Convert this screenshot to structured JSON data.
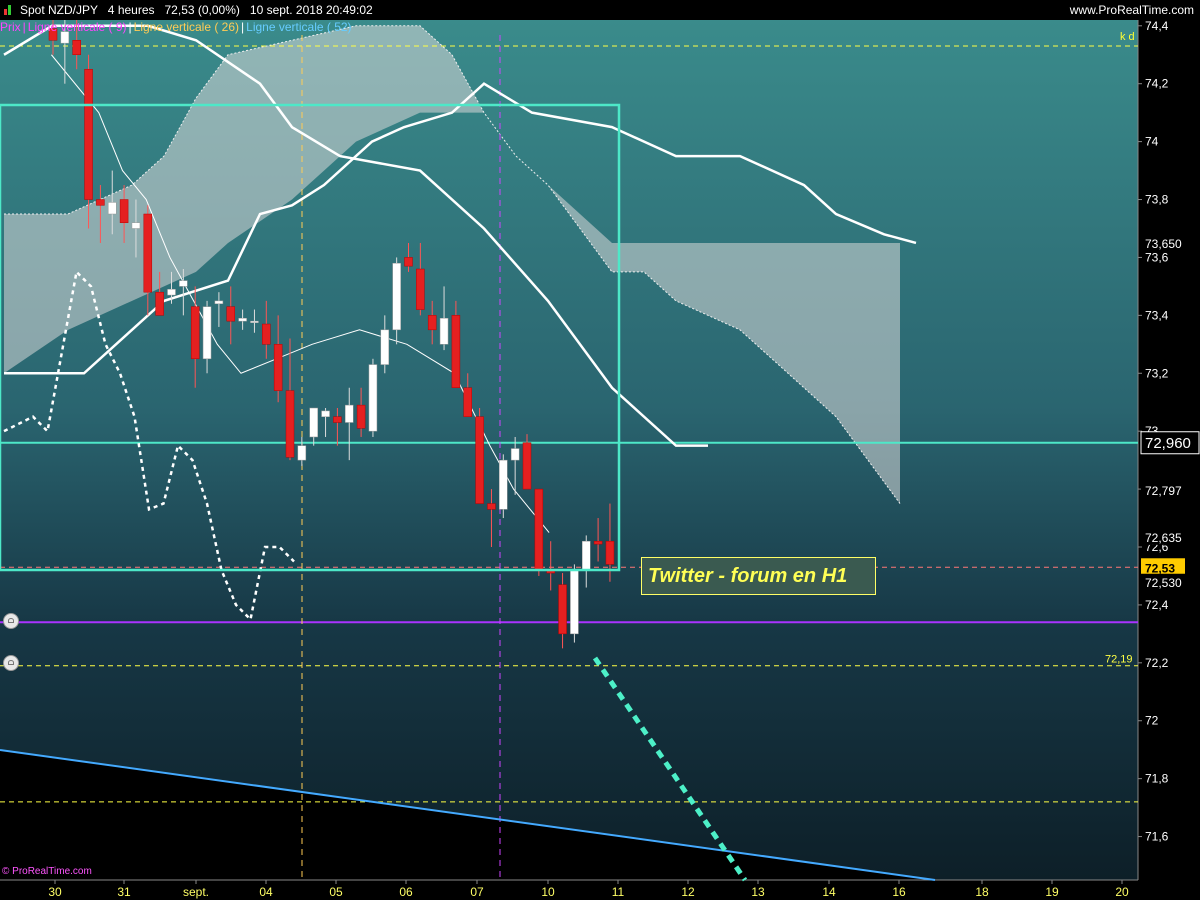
{
  "header": {
    "title": "Spot NZD/JPY   4 heures   72,53 (0,00%)   10 sept. 2018 20:49:02",
    "site": "www.ProRealTime.com"
  },
  "legend": [
    {
      "label": "Prix",
      "color": "#ff44ff"
    },
    {
      "label": "Ligne verticale ( 9)",
      "color": "#ff44ff"
    },
    {
      "label": "Ligne verticale ( 26)",
      "color": "#ffcc55"
    },
    {
      "label": "Ligne verticale ( 52)",
      "color": "#66ccff"
    }
  ],
  "annotation": {
    "kd": "k d",
    "twitter": "Twitter - forum en H1",
    "level": "72,19"
  },
  "footer": {
    "copyright": "© ProRealTime.com"
  },
  "colors": {
    "up": "#ffffff",
    "down": "#e52020",
    "cloud": "#d8d8d8",
    "box": "#4de8c8",
    "trend": "#4df0c8",
    "support": "#44aaff"
  },
  "chart_data": {
    "type": "candlestick",
    "ylim": [
      71.45,
      74.42
    ],
    "y_ticks": [
      "74,4",
      "74,2",
      "74",
      "73,8",
      "73,6",
      "73,4",
      "73,2",
      "73",
      "72,8",
      "72,6",
      "72,4",
      "72,2",
      "72",
      "71,8",
      "71,6"
    ],
    "price_labels": [
      {
        "text": "72,960",
        "value": 72.96,
        "style": "box-white"
      },
      {
        "text": "73,650",
        "value": 73.65,
        "style": "plain"
      },
      {
        "text": "72,797",
        "value": 72.797,
        "style": "plain"
      },
      {
        "text": "72,635",
        "value": 72.635,
        "style": "plain"
      },
      {
        "text": "72,53",
        "value": 72.53,
        "style": "box-yellow"
      },
      {
        "text": "72,530",
        "value": 72.48,
        "style": "plain"
      }
    ],
    "x_ticks": [
      "30",
      "31",
      "sept.",
      "04",
      "05",
      "06",
      "07",
      "10",
      "11",
      "12",
      "13",
      "14",
      "16",
      "18",
      "19",
      "20"
    ],
    "horizontal_lines": [
      {
        "value": 74.33,
        "color": "#ffff44",
        "dash": true
      },
      {
        "value": 72.96,
        "color": "#4de8c8",
        "dash": false
      },
      {
        "value": 72.53,
        "color": "#ff7777",
        "dash": true
      },
      {
        "value": 72.34,
        "color": "#aa33ff",
        "dash": false
      },
      {
        "value": 72.19,
        "color": "#ffff44",
        "dash": true
      },
      {
        "value": 71.72,
        "color": "#ffff44",
        "dash": true
      }
    ],
    "candles": [
      {
        "o": 74.39,
        "h": 74.42,
        "l": 74.3,
        "c": 74.35
      },
      {
        "o": 74.34,
        "h": 74.42,
        "l": 74.2,
        "c": 74.38
      },
      {
        "o": 74.35,
        "h": 74.42,
        "l": 74.25,
        "c": 74.3
      },
      {
        "o": 74.25,
        "h": 74.3,
        "l": 73.7,
        "c": 73.8
      },
      {
        "o": 73.8,
        "h": 73.85,
        "l": 73.65,
        "c": 73.78
      },
      {
        "o": 73.75,
        "h": 73.9,
        "l": 73.68,
        "c": 73.79
      },
      {
        "o": 73.8,
        "h": 73.85,
        "l": 73.65,
        "c": 73.72
      },
      {
        "o": 73.7,
        "h": 73.8,
        "l": 73.6,
        "c": 73.72
      },
      {
        "o": 73.75,
        "h": 73.78,
        "l": 73.4,
        "c": 73.48
      },
      {
        "o": 73.48,
        "h": 73.55,
        "l": 73.4,
        "c": 73.4
      },
      {
        "o": 73.47,
        "h": 73.55,
        "l": 73.44,
        "c": 73.49
      },
      {
        "o": 73.5,
        "h": 73.56,
        "l": 73.4,
        "c": 73.52
      },
      {
        "o": 73.43,
        "h": 73.5,
        "l": 73.15,
        "c": 73.25
      },
      {
        "o": 73.25,
        "h": 73.45,
        "l": 73.2,
        "c": 73.43
      },
      {
        "o": 73.44,
        "h": 73.48,
        "l": 73.36,
        "c": 73.45
      },
      {
        "o": 73.43,
        "h": 73.5,
        "l": 73.3,
        "c": 73.38
      },
      {
        "o": 73.38,
        "h": 73.42,
        "l": 73.35,
        "c": 73.39
      },
      {
        "o": 73.38,
        "h": 73.42,
        "l": 73.34,
        "c": 73.38
      },
      {
        "o": 73.37,
        "h": 73.45,
        "l": 73.25,
        "c": 73.3
      },
      {
        "o": 73.3,
        "h": 73.4,
        "l": 73.1,
        "c": 73.14
      },
      {
        "o": 73.14,
        "h": 73.32,
        "l": 72.9,
        "c": 72.91
      },
      {
        "o": 72.9,
        "h": 72.98,
        "l": 72.88,
        "c": 72.95
      },
      {
        "o": 72.98,
        "h": 73.05,
        "l": 72.95,
        "c": 73.08
      },
      {
        "o": 73.05,
        "h": 73.08,
        "l": 72.98,
        "c": 73.07
      },
      {
        "o": 73.05,
        "h": 73.08,
        "l": 72.95,
        "c": 73.03
      },
      {
        "o": 73.03,
        "h": 73.15,
        "l": 72.9,
        "c": 73.09
      },
      {
        "o": 73.09,
        "h": 73.15,
        "l": 72.98,
        "c": 73.01
      },
      {
        "o": 73.0,
        "h": 73.25,
        "l": 72.98,
        "c": 73.23
      },
      {
        "o": 73.23,
        "h": 73.4,
        "l": 73.2,
        "c": 73.35
      },
      {
        "o": 73.35,
        "h": 73.6,
        "l": 73.3,
        "c": 73.58
      },
      {
        "o": 73.6,
        "h": 73.65,
        "l": 73.55,
        "c": 73.57
      },
      {
        "o": 73.56,
        "h": 73.65,
        "l": 73.4,
        "c": 73.42
      },
      {
        "o": 73.4,
        "h": 73.45,
        "l": 73.3,
        "c": 73.35
      },
      {
        "o": 73.3,
        "h": 73.5,
        "l": 73.28,
        "c": 73.39
      },
      {
        "o": 73.4,
        "h": 73.45,
        "l": 73.15,
        "c": 73.15
      },
      {
        "o": 73.15,
        "h": 73.2,
        "l": 73.05,
        "c": 73.05
      },
      {
        "o": 73.05,
        "h": 73.08,
        "l": 72.75,
        "c": 72.75
      },
      {
        "o": 72.75,
        "h": 72.8,
        "l": 72.6,
        "c": 72.73
      },
      {
        "o": 72.73,
        "h": 72.92,
        "l": 72.7,
        "c": 72.9
      },
      {
        "o": 72.9,
        "h": 72.98,
        "l": 72.78,
        "c": 72.94
      },
      {
        "o": 72.96,
        "h": 72.99,
        "l": 72.8,
        "c": 72.8
      },
      {
        "o": 72.8,
        "h": 72.8,
        "l": 72.5,
        "c": 72.52
      },
      {
        "o": 72.52,
        "h": 72.62,
        "l": 72.45,
        "c": 72.51
      },
      {
        "o": 72.47,
        "h": 72.51,
        "l": 72.25,
        "c": 72.3
      },
      {
        "o": 72.3,
        "h": 72.54,
        "l": 72.27,
        "c": 72.52
      },
      {
        "o": 72.52,
        "h": 72.64,
        "l": 72.46,
        "c": 72.62
      },
      {
        "o": 72.62,
        "h": 72.7,
        "l": 72.55,
        "c": 72.61
      },
      {
        "o": 72.62,
        "h": 72.75,
        "l": 72.48,
        "c": 72.54
      }
    ],
    "series": [
      {
        "style": "white-thick",
        "values": [
          [
            0,
            74.3
          ],
          [
            3,
            74.4
          ],
          [
            9,
            74.4
          ],
          [
            12,
            74.35
          ],
          [
            16,
            74.2
          ],
          [
            18,
            74.05
          ],
          [
            21,
            73.95
          ],
          [
            26,
            73.9
          ],
          [
            30,
            73.7
          ],
          [
            34,
            73.45
          ],
          [
            38,
            73.15
          ],
          [
            42,
            72.95
          ],
          [
            44,
            72.95
          ]
        ]
      },
      {
        "style": "white-thick-2",
        "values": [
          [
            0,
            73.2
          ],
          [
            5,
            73.2
          ],
          [
            8,
            73.35
          ],
          [
            10,
            73.45
          ],
          [
            14,
            73.52
          ],
          [
            16,
            73.75
          ],
          [
            18,
            73.78
          ],
          [
            20,
            73.85
          ],
          [
            23,
            74.0
          ],
          [
            25,
            74.05
          ],
          [
            28,
            74.1
          ],
          [
            30,
            74.2
          ],
          [
            33,
            74.1
          ],
          [
            38,
            74.05
          ],
          [
            42,
            73.95
          ],
          [
            46,
            73.95
          ],
          [
            50,
            73.85
          ],
          [
            52,
            73.75
          ],
          [
            55,
            73.68
          ],
          [
            57,
            73.65
          ]
        ]
      },
      {
        "style": "white-thin",
        "values": [
          [
            4,
            74.3
          ],
          [
            8,
            74.1
          ],
          [
            10,
            73.9
          ],
          [
            12,
            73.8
          ],
          [
            14,
            73.6
          ],
          [
            16,
            73.45
          ],
          [
            18,
            73.3
          ],
          [
            20,
            73.2
          ],
          [
            23,
            73.25
          ],
          [
            26,
            73.3
          ],
          [
            30,
            73.35
          ],
          [
            34,
            73.3
          ],
          [
            38,
            73.2
          ],
          [
            41,
            72.95
          ],
          [
            43,
            72.8
          ],
          [
            46,
            72.65
          ]
        ]
      },
      {
        "style": "white-dotted",
        "values": [
          [
            0,
            73.0
          ],
          [
            2,
            73.05
          ],
          [
            3,
            73.0
          ],
          [
            5,
            73.55
          ],
          [
            6,
            73.5
          ],
          [
            7,
            73.3
          ],
          [
            8,
            73.2
          ],
          [
            9,
            73.05
          ],
          [
            10,
            72.73
          ],
          [
            11,
            72.75
          ],
          [
            12,
            72.95
          ],
          [
            13,
            72.9
          ],
          [
            14,
            72.75
          ],
          [
            15,
            72.52
          ],
          [
            16,
            72.4
          ],
          [
            17,
            72.35
          ],
          [
            18,
            72.6
          ],
          [
            19,
            72.6
          ],
          [
            20,
            72.55
          ]
        ]
      }
    ],
    "cloud": {
      "upper": [
        [
          0,
          73.75
        ],
        [
          4,
          73.75
        ],
        [
          8,
          73.85
        ],
        [
          10,
          73.95
        ],
        [
          12,
          74.15
        ],
        [
          14,
          74.3
        ],
        [
          18,
          74.35
        ],
        [
          22,
          74.4
        ],
        [
          26,
          74.4
        ],
        [
          28,
          74.3
        ],
        [
          30,
          74.1
        ],
        [
          32,
          73.95
        ],
        [
          34,
          73.85
        ],
        [
          36,
          73.7
        ],
        [
          38,
          73.55
        ],
        [
          40,
          73.55
        ],
        [
          42,
          73.45
        ],
        [
          44,
          73.4
        ],
        [
          46,
          73.35
        ],
        [
          48,
          73.25
        ],
        [
          50,
          73.15
        ],
        [
          52,
          73.05
        ],
        [
          54,
          72.9
        ],
        [
          56,
          72.75
        ]
      ],
      "lower": [
        [
          0,
          73.2
        ],
        [
          4,
          73.35
        ],
        [
          8,
          73.45
        ],
        [
          10,
          73.5
        ],
        [
          12,
          73.55
        ],
        [
          14,
          73.65
        ],
        [
          18,
          73.8
        ],
        [
          20,
          73.9
        ],
        [
          22,
          74.0
        ],
        [
          24,
          74.05
        ],
        [
          26,
          74.1
        ],
        [
          28,
          74.1
        ],
        [
          30,
          74.1
        ],
        [
          32,
          73.95
        ],
        [
          34,
          73.85
        ],
        [
          36,
          73.75
        ],
        [
          38,
          73.65
        ],
        [
          40,
          73.65
        ],
        [
          42,
          73.65
        ],
        [
          44,
          73.65
        ],
        [
          46,
          73.65
        ],
        [
          48,
          73.65
        ],
        [
          50,
          73.65
        ],
        [
          52,
          73.65
        ],
        [
          54,
          73.65
        ],
        [
          56,
          73.65
        ]
      ]
    }
  }
}
